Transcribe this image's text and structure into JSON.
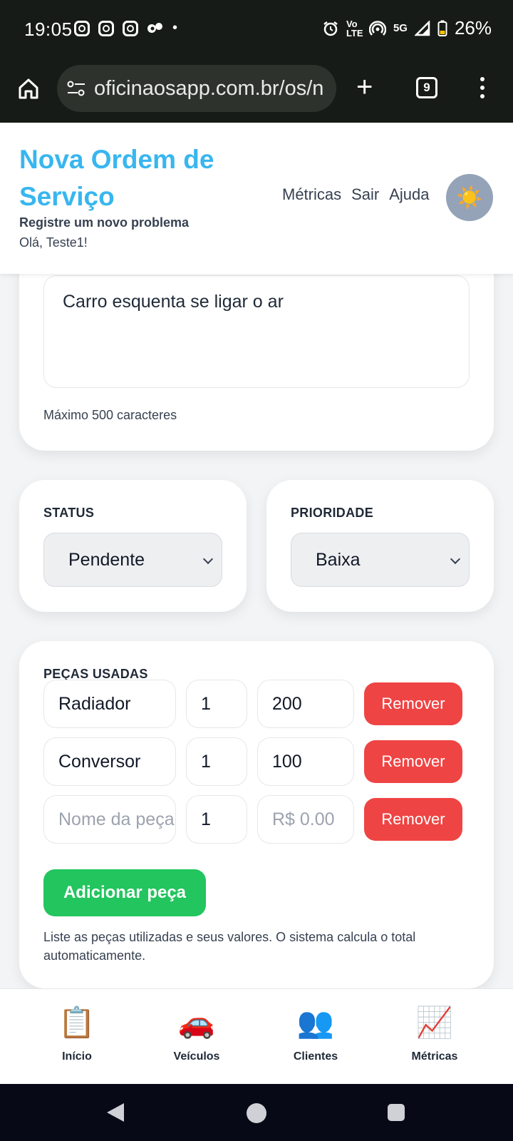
{
  "status_bar": {
    "time": "19:05",
    "network": "5G",
    "volte": "Vo LTE",
    "battery": "26%"
  },
  "browser": {
    "url": "oficinaosapp.com.br/os/n",
    "tab_count": "9"
  },
  "header": {
    "title": "Nova Ordem de Serviço",
    "subtitle": "Registre um novo problema",
    "greeting": "Olá, Teste1!",
    "nav": [
      "Métricas",
      "Sair",
      "Ajuda"
    ],
    "theme_icon": "☀️"
  },
  "description": {
    "value": "Carro esquenta se ligar o ar",
    "hint": "Máximo 500 caracteres"
  },
  "status": {
    "label": "STATUS",
    "value": "Pendente"
  },
  "priority": {
    "label": "PRIORIDADE",
    "value": "Baixa"
  },
  "parts": {
    "label": "PEÇAS USADAS",
    "rows": [
      {
        "name": "Radiador",
        "qty": "1",
        "price": "200",
        "remove": "Remover"
      },
      {
        "name": "Conversor",
        "qty": "1",
        "price": "100",
        "remove": "Remover"
      },
      {
        "name_placeholder": "Nome da peça",
        "qty": "1",
        "price_placeholder": "R$ 0.00",
        "remove": "Remover"
      }
    ],
    "add_label": "Adicionar peça",
    "help": "Liste as peças utilizadas e seus valores. O sistema calcula o total automaticamente."
  },
  "bottom_nav": [
    {
      "label": "Início",
      "icon": "📋",
      "icon_name": "clipboard-icon"
    },
    {
      "label": "Veículos",
      "icon": "🚗",
      "icon_name": "car-icon"
    },
    {
      "label": "Clientes",
      "icon": "👥",
      "icon_name": "users-icon"
    },
    {
      "label": "Métricas",
      "icon": "📈",
      "icon_name": "chart-icon"
    }
  ],
  "colors": {
    "title": "#38b6ef",
    "remove": "#ef4444",
    "add": "#22c55e"
  }
}
